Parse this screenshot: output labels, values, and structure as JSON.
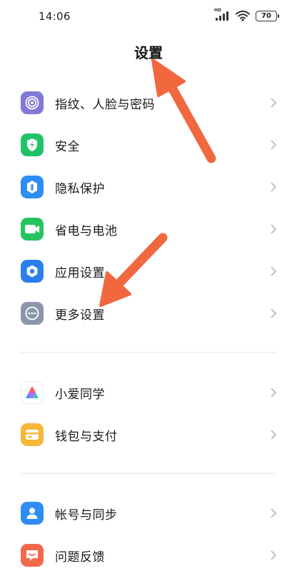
{
  "status_bar": {
    "time": "14:06",
    "battery": "70",
    "network_badge": "HD"
  },
  "header": {
    "title": "设置"
  },
  "settings": [
    {
      "label": "指纹、人脸与密码",
      "icon": "fingerprint-icon",
      "color": "#7f79d8"
    },
    {
      "label": "安全",
      "icon": "shield-icon",
      "color": "#20c267"
    },
    {
      "label": "隐私保护",
      "icon": "privacy-icon",
      "color": "#2d8df5"
    },
    {
      "label": "省电与电池",
      "icon": "battery-icon",
      "color": "#25c45f"
    },
    {
      "label": "应用设置",
      "icon": "gear-icon",
      "color": "#2b7ef0"
    },
    {
      "label": "更多设置",
      "icon": "more-icon",
      "color": "#8c96a8"
    },
    {
      "label": "小爱同学",
      "icon": "xiaoai-icon",
      "color": "#ffffff"
    },
    {
      "label": "钱包与支付",
      "icon": "wallet-icon",
      "color": "#f5b63a"
    },
    {
      "label": "帐号与同步",
      "icon": "account-icon",
      "color": "#2e8cf3"
    },
    {
      "label": "问题反馈",
      "icon": "feedback-icon",
      "color": "#f2694b"
    }
  ],
  "annotation_color": "#f1683f"
}
